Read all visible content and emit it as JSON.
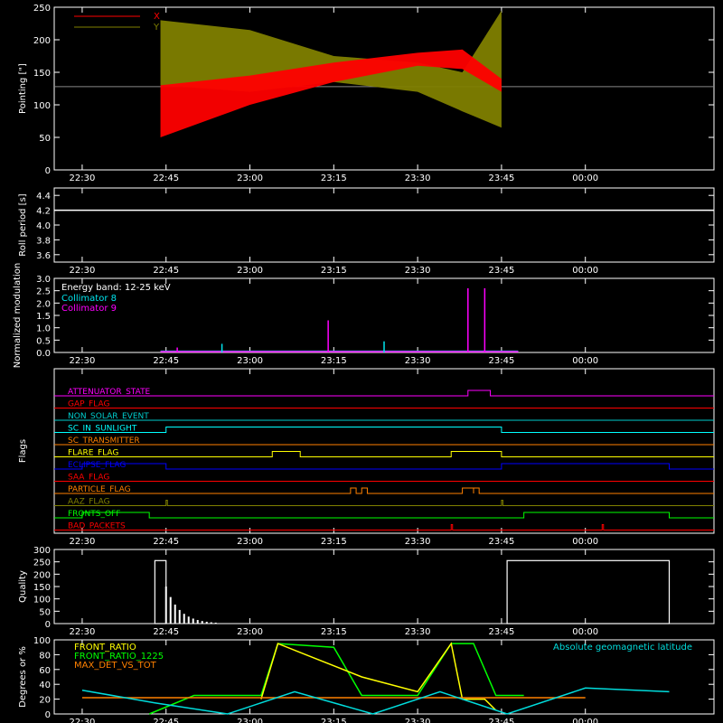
{
  "colors": {
    "background": "#000000",
    "axis": "#ffffff",
    "x_series": "#ff0000",
    "y_series": "#808000",
    "collimator8": "#00e5ee",
    "collimator9": "#ff00ff",
    "quality": "#ffffff",
    "front_ratio": "#ffff00",
    "front_ratio_1225": "#00ff00",
    "max_det_vs_tot": "#ff8000",
    "geomag_lat": "#00dddd"
  },
  "chart_data": [
    {
      "type": "line",
      "title": "",
      "ylabel": "Pointing [\"]",
      "ylim": [
        0,
        250
      ],
      "yticks": [
        "0",
        "50",
        "100",
        "150",
        "200",
        "250"
      ],
      "xlim_hours": [
        22.42,
        24.3
      ],
      "xticks": [
        "22:30",
        "22:45",
        "23:00",
        "23:15",
        "23:30",
        "23:45",
        "00:00"
      ],
      "legend": [
        {
          "name": "X",
          "color": "#ff0000"
        },
        {
          "name": "Y",
          "color": "#808000"
        }
      ],
      "reference_line": 128,
      "series": [
        {
          "name": "X",
          "x": [
            "22:44",
            "23:00",
            "23:15",
            "23:30",
            "23:38",
            "23:45"
          ],
          "low": [
            50,
            100,
            135,
            160,
            155,
            120
          ],
          "high": [
            130,
            145,
            165,
            180,
            185,
            140
          ]
        },
        {
          "name": "Y",
          "x": [
            "22:44",
            "23:00",
            "23:15",
            "23:30",
            "23:38",
            "23:45"
          ],
          "low": [
            130,
            120,
            135,
            120,
            90,
            65
          ],
          "high": [
            230,
            215,
            175,
            165,
            150,
            245
          ]
        }
      ]
    },
    {
      "type": "line",
      "ylabel": "Roll period [s]",
      "ylim": [
        3.5,
        4.5
      ],
      "yticks": [
        "3.6",
        "3.8",
        "4.0",
        "4.2",
        "4.4"
      ],
      "xticks": [
        "22:30",
        "22:45",
        "23:00",
        "23:15",
        "23:30",
        "23:45",
        "00:00"
      ],
      "value": 4.2
    },
    {
      "type": "line",
      "ylabel": "Normalized modulation",
      "ylim": [
        0,
        3.0
      ],
      "yticks": [
        "0.0",
        "0.5",
        "1.0",
        "1.5",
        "2.0",
        "2.5",
        "3.0"
      ],
      "xticks": [
        "22:30",
        "22:45",
        "23:00",
        "23:15",
        "23:30",
        "23:45",
        "00:00"
      ],
      "annotation": "Energy band: 12-25 keV",
      "legend": [
        {
          "name": "Collimator 8",
          "color": "#00e5ee"
        },
        {
          "name": "Collimator 9",
          "color": "#ff00ff"
        }
      ],
      "spikes": [
        {
          "x": "22:47",
          "y": 0.2
        },
        {
          "x": "22:55",
          "y": 0.35
        },
        {
          "x": "23:14",
          "y": 1.3
        },
        {
          "x": "23:24",
          "y": 0.45
        },
        {
          "x": "23:39",
          "y": 2.6
        },
        {
          "x": "23:42",
          "y": 2.6
        }
      ]
    },
    {
      "type": "step",
      "ylabel": "Flags",
      "xticks": [
        "22:30",
        "22:45",
        "23:00",
        "23:15",
        "23:30",
        "23:45",
        "00:00"
      ],
      "flags": [
        {
          "name": "ATTENUATOR_STATE",
          "color": "#ff00ff",
          "on": [
            [
              "23:39",
              "23:43"
            ]
          ]
        },
        {
          "name": "GAP_FLAG",
          "color": "#ff0000",
          "on": []
        },
        {
          "name": "NON_SOLAR_EVENT",
          "color": "#00cccc",
          "on": []
        },
        {
          "name": "SC_IN_SUNLIGHT",
          "color": "#00ffff",
          "on": [
            [
              "22:45",
              "23:45"
            ]
          ]
        },
        {
          "name": "SC_TRANSMITTER",
          "color": "#ff8000",
          "on": []
        },
        {
          "name": "FLARE_FLAG",
          "color": "#ffff00",
          "on": [
            [
              "23:04",
              "23:09"
            ],
            [
              "23:36",
              "23:45"
            ]
          ]
        },
        {
          "name": "ECLIPSE_FLAG",
          "color": "#0000ff",
          "on": [
            [
              "22:30",
              "22:45"
            ],
            [
              "23:45",
              "00:15"
            ]
          ]
        },
        {
          "name": "SAA_FLAG",
          "color": "#ff0000",
          "on": []
        },
        {
          "name": "PARTICLE_FLAG",
          "color": "#ff8000",
          "on": [
            [
              "23:18",
              "23:19"
            ],
            [
              "23:20",
              "23:21"
            ],
            [
              "23:38",
              "23:40"
            ],
            [
              "23:40",
              "23:41"
            ]
          ]
        },
        {
          "name": "AAZ_FLAG",
          "color": "#808000",
          "on": [
            [
              "22:45",
              "22:45"
            ],
            [
              "23:45",
              "23:45"
            ]
          ]
        },
        {
          "name": "FRONTS_OFF",
          "color": "#00ff00",
          "on": [
            [
              "22:30",
              "22:42"
            ],
            [
              "23:49",
              "00:15"
            ]
          ]
        },
        {
          "name": "BAD_PACKETS",
          "color": "#ff0000",
          "on": [
            [
              "23:36",
              "23:36"
            ],
            [
              "00:03",
              "00:03"
            ]
          ]
        }
      ]
    },
    {
      "type": "bar",
      "ylabel": "Quality",
      "ylim": [
        0,
        300
      ],
      "yticks": [
        "0",
        "50",
        "100",
        "150",
        "200",
        "250",
        "300"
      ],
      "xticks": [
        "22:30",
        "22:45",
        "23:00",
        "23:15",
        "23:30",
        "23:45",
        "00:00"
      ],
      "segments": [
        {
          "from": "22:43",
          "to": "22:45",
          "value": 255
        },
        {
          "from": "23:46",
          "to": "00:15",
          "value": 255
        }
      ]
    },
    {
      "type": "line",
      "ylabel": "Degrees or %",
      "ylim": [
        0,
        100
      ],
      "yticks": [
        "0",
        "20",
        "40",
        "60",
        "80",
        "100"
      ],
      "xticks": [
        "22:30",
        "22:45",
        "23:00",
        "23:15",
        "23:30",
        "23:45",
        "00:00"
      ],
      "legend": [
        {
          "name": "FRONT_RATIO",
          "color": "#ffff00"
        },
        {
          "name": "FRONT_RATIO_1225",
          "color": "#00ff00"
        },
        {
          "name": "MAX_DET_VS_TOT",
          "color": "#ff8000"
        }
      ],
      "right_label": "Absolute geomagnetic latitude",
      "series": [
        {
          "name": "FRONT_RATIO_1225",
          "x": [
            "22:42",
            "22:50",
            "23:02",
            "23:05",
            "23:15",
            "23:20",
            "23:30",
            "23:36",
            "23:40",
            "23:44",
            "23:49"
          ],
          "y": [
            0,
            25,
            25,
            95,
            90,
            25,
            25,
            95,
            95,
            25,
            25
          ]
        },
        {
          "name": "FRONT_RATIO",
          "x": [
            "23:02",
            "23:05",
            "23:10",
            "23:20",
            "23:30",
            "23:36",
            "23:38",
            "23:42",
            "23:44"
          ],
          "y": [
            20,
            95,
            80,
            50,
            30,
            95,
            20,
            20,
            5
          ]
        },
        {
          "name": "MAX_DET_VS_TOT",
          "x": [
            "22:30",
            "23:00",
            "23:30",
            "00:00"
          ],
          "y": [
            22,
            22,
            22,
            22
          ]
        },
        {
          "name": "geomag",
          "x": [
            "22:30",
            "22:43",
            "22:56",
            "23:08",
            "23:22",
            "23:34",
            "23:46",
            "00:00",
            "00:15"
          ],
          "y": [
            32,
            15,
            0,
            30,
            0,
            30,
            0,
            35,
            30
          ]
        }
      ]
    }
  ]
}
